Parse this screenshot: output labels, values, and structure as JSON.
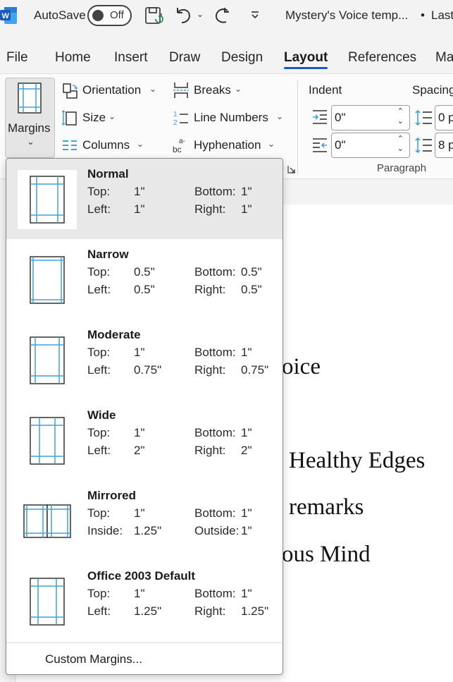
{
  "titlebar": {
    "autosave_label": "AutoSave",
    "autosave_state": "Off",
    "doc_title": "Mystery's Voice temp...",
    "bullet": "•",
    "last_modified": "Last"
  },
  "tabs": [
    "File",
    "Home",
    "Insert",
    "Draw",
    "Design",
    "Layout",
    "References",
    "Ma"
  ],
  "ribbon": {
    "margins_label": "Margins",
    "orientation_label": "Orientation",
    "size_label": "Size",
    "columns_label": "Columns",
    "breaks_label": "Breaks",
    "line_numbers_label": "Line Numbers",
    "hyphenation_label": "Hyphenation",
    "indent_label": "Indent",
    "spacing_label": "Spacing",
    "indent_left_value": "0\"",
    "indent_right_value": "0\"",
    "spacing_before_value": "0 p",
    "spacing_after_value": "8 p",
    "paragraph_group_label": "Paragraph"
  },
  "menu": {
    "options": [
      {
        "name": "Normal",
        "k1": "Top:",
        "v1": "1\"",
        "k2": "Bottom:",
        "v2": "1\"",
        "k3": "Left:",
        "v3": "1\"",
        "k4": "Right:",
        "v4": "1\""
      },
      {
        "name": "Narrow",
        "k1": "Top:",
        "v1": "0.5\"",
        "k2": "Bottom:",
        "v2": "0.5\"",
        "k3": "Left:",
        "v3": "0.5\"",
        "k4": "Right:",
        "v4": "0.5\""
      },
      {
        "name": "Moderate",
        "k1": "Top:",
        "v1": "1\"",
        "k2": "Bottom:",
        "v2": "1\"",
        "k3": "Left:",
        "v3": "0.75\"",
        "k4": "Right:",
        "v4": "0.75\""
      },
      {
        "name": "Wide",
        "k1": "Top:",
        "v1": "1\"",
        "k2": "Bottom:",
        "v2": "1\"",
        "k3": "Left:",
        "v3": "2\"",
        "k4": "Right:",
        "v4": "2\""
      },
      {
        "name": "Mirrored",
        "k1": "Top:",
        "v1": "1\"",
        "k2": "Bottom:",
        "v2": "1\"",
        "k3": "Inside:",
        "v3": "1.25\"",
        "k4": "Outside:",
        "v4": "1\""
      },
      {
        "name": "Office 2003 Default",
        "k1": "Top:",
        "v1": "1\"",
        "k2": "Bottom:",
        "v2": "1\"",
        "k3": "Left:",
        "v3": "1.25\"",
        "k4": "Right:",
        "v4": "1.25\""
      }
    ],
    "custom_margins_label": "Custom Margins..."
  },
  "document": {
    "lines": [
      "oice",
      "Healthy Edges",
      "remarks",
      "ous Mind"
    ]
  },
  "colors": {
    "accent": "#185abd",
    "word_blue": "#185abd",
    "margin_guide": "#3fa3d6",
    "selected_bg": "#e8e8e8"
  }
}
